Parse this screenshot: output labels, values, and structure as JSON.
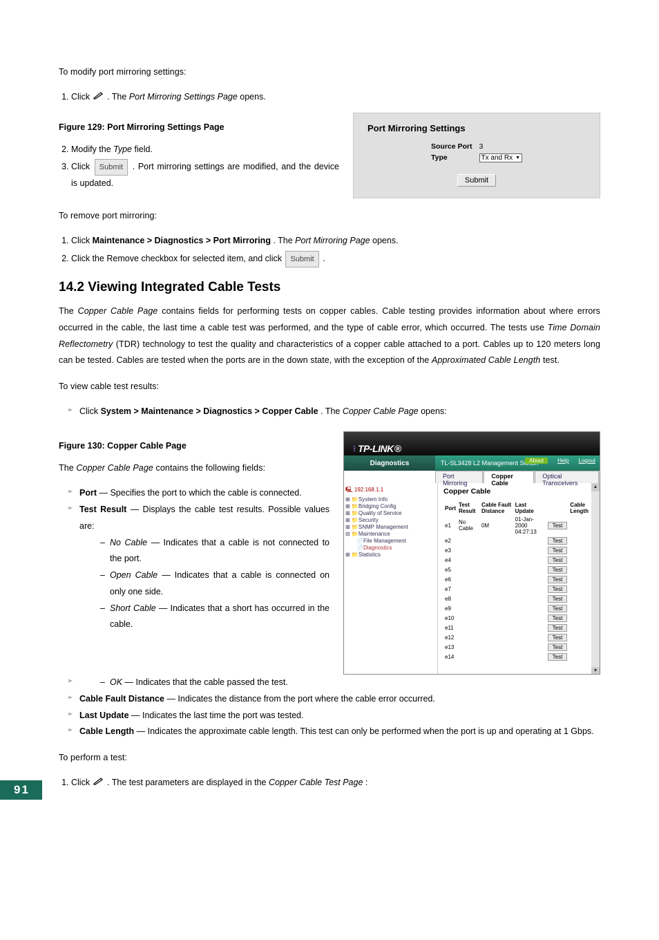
{
  "intro": "To modify port mirroring settings:",
  "step1_a": "Click ",
  "step1_b": " . The ",
  "step1_c": "Port Mirroring Settings Page",
  "step1_d": " opens.",
  "fig129_label": "Figure 129: Port Mirroring Settings Page",
  "step2_a": "Modify the ",
  "step2_b": "Type",
  "step2_c": " field.",
  "step3_a": "Click ",
  "step3_btn": "Submit",
  "step3_b": ". Port mirroring settings are modified, and the device is updated.",
  "fig129": {
    "title": "Port Mirroring Settings",
    "row1_label": "Source Port",
    "row1_val": "3",
    "row2_label": "Type",
    "row2_val": "Tx and Rx",
    "submit": "Submit"
  },
  "remove_intro": "To remove port mirroring:",
  "remove_s1_a": "Click ",
  "remove_s1_b": "Maintenance > Diagnostics > Port Mirroring",
  "remove_s1_c": ". The ",
  "remove_s1_d": "Port Mirroring Page",
  "remove_s1_e": " opens.",
  "remove_s2_a": "Click the Remove checkbox for selected item, and click ",
  "remove_s2_btn": "Submit",
  "remove_s2_b": ".",
  "section_title": "14.2   Viewing Integrated Cable Tests",
  "body_a": "The ",
  "body_b": "Copper Cable Page",
  "body_c": " contains fields for performing tests on copper cables. Cable testing provides information about where errors occurred in the cable, the last time a cable test was performed, and the type of cable error, which occurred. The tests use ",
  "body_d": "Time Domain Reflectometry",
  "body_e": " (TDR) technology to test the quality and characteristics of a copper cable attached to a port. Cables up to 120 meters long can be tested. Cables are tested when the ports are in the down state, with the exception of the ",
  "body_f": "Approximated Cable Length",
  "body_g": " test.",
  "view_intro": "To view cable test results:",
  "view_s1_a": "Click ",
  "view_s1_b": "System > Maintenance > Diagnostics > Copper Cable",
  "view_s1_c": ". The ",
  "view_s1_d": "Copper Cable Page",
  "view_s1_e": " opens:",
  "fig130_label": "Figure 130: Copper Cable Page",
  "fields_intro_a": "The ",
  "fields_intro_b": "Copper Cable Page",
  "fields_intro_c": " contains the following fields:",
  "field_port_a": "Port",
  "field_port_b": " — Specifies the port to which the cable is connected.",
  "field_tr_a": "Test Result",
  "field_tr_b": " — Displays the cable test results. Possible values are:",
  "sub_nc_a": "No Cable",
  "sub_nc_b": " — Indicates that a cable is not connected to the port.",
  "sub_oc_a": "Open Cable",
  "sub_oc_b": " — Indicates that a cable is connected on only one side.",
  "sub_sc_a": "Short Cable",
  "sub_sc_b": " — Indicates that a short has occurred in the cable.",
  "sub_ok_a": "OK",
  "sub_ok_b": " — Indicates that the cable passed the test.",
  "field_cfd_a": "Cable Fault Distance",
  "field_cfd_b": " — Indicates the distance from the port where the cable error occurred.",
  "field_lu_a": "Last Update",
  "field_lu_b": " — Indicates the last time the port was tested.",
  "field_cl_a": "Cable Length",
  "field_cl_b": " — Indicates the approximate cable length. This test can only be performed when the port is up and operating at 1 Gbps.",
  "perform_intro": "To perform a test:",
  "perform_s1_a": "Click ",
  "perform_s1_b": " . The test parameters are displayed in the ",
  "perform_s1_c": "Copper Cable Test Page",
  "perform_s1_d": ":",
  "ss": {
    "logo": "TP-LINK",
    "nav_title": "Diagnostics",
    "header": "TL-SL3428 L2 Management Switch",
    "about": "About",
    "help": "Help",
    "logout": "Logout",
    "tabs": [
      "Port Mirroring",
      "Copper Cable",
      "Optical Transceivers"
    ],
    "tree": [
      "192.168.1.1",
      "System Info",
      "Bridging Config",
      "Quality of Service",
      "Security",
      "SNMP Management",
      "Maintenance",
      "File Management",
      "Diagnostics",
      "Statistics"
    ],
    "title": "Copper Cable",
    "cols": [
      "Port",
      "Test Result",
      "Cable Fault Distance",
      "Last Update",
      "",
      "Cable Length"
    ],
    "row1": {
      "port": "e1",
      "res": "No Cable",
      "dist": "0M",
      "upd": "01-Jan-2000 04:27:13"
    },
    "ports": [
      "e2",
      "e3",
      "e4",
      "e5",
      "e6",
      "e7",
      "e8",
      "e9",
      "e10",
      "e11",
      "e12",
      "e13",
      "e14"
    ],
    "test": "Test"
  },
  "page_number": "91"
}
